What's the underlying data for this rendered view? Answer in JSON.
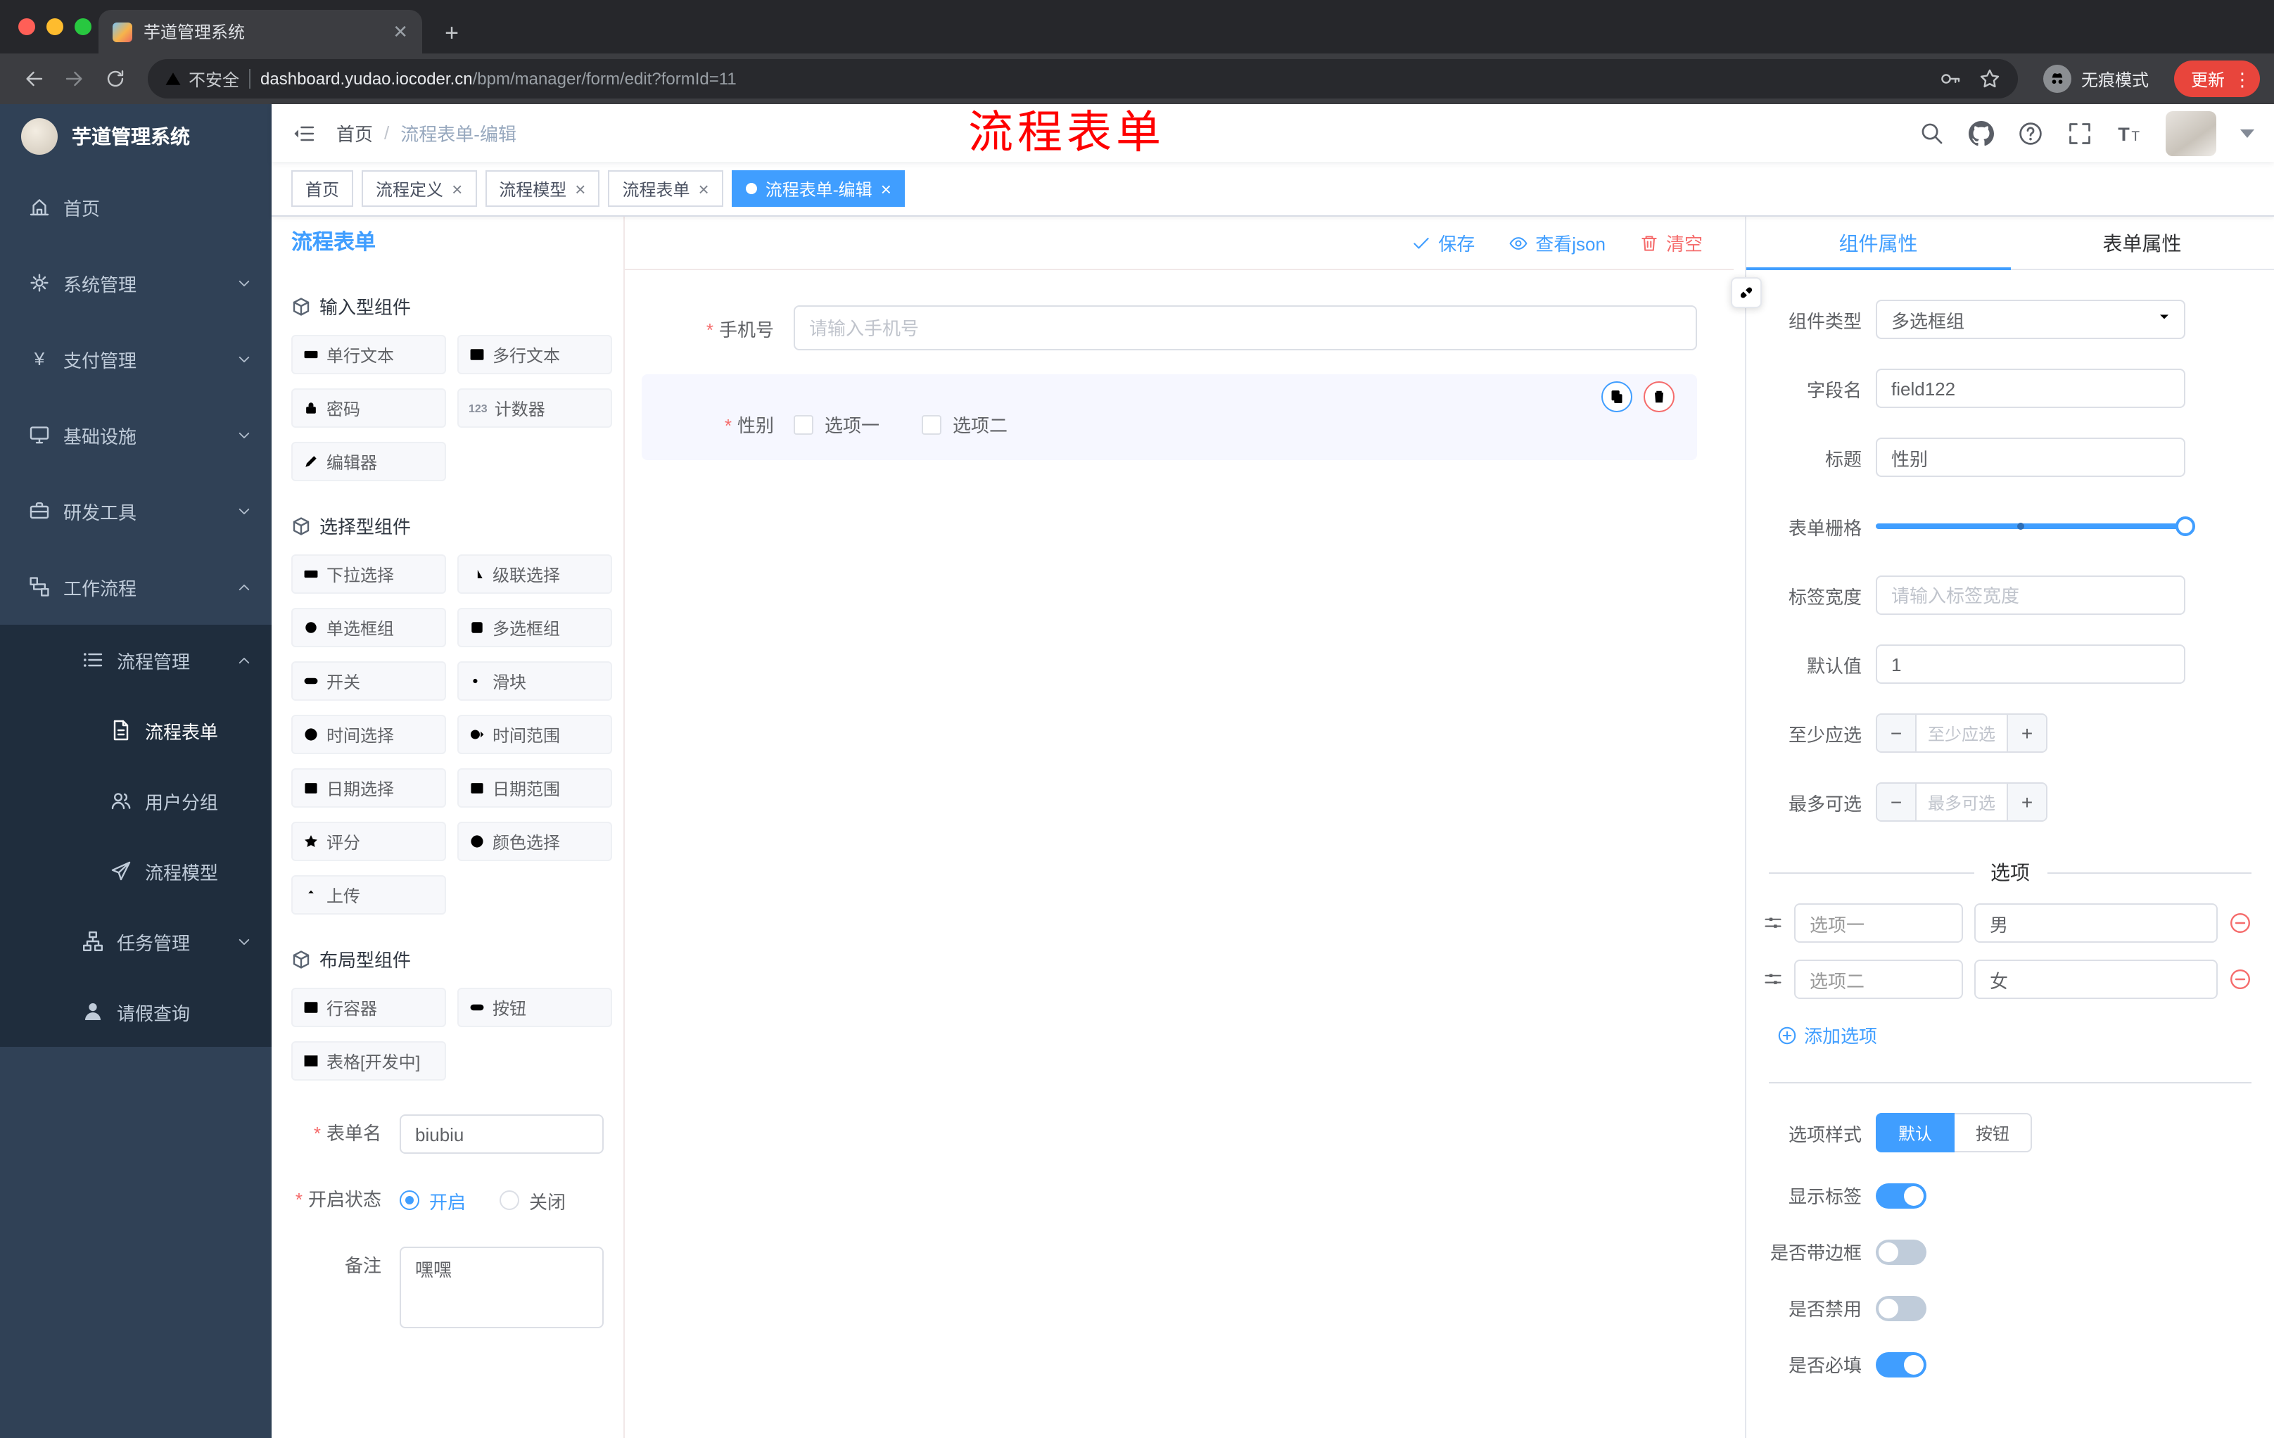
{
  "browser": {
    "tab_title": "芋道管理系统",
    "security_label": "不安全",
    "url_domain": "dashboard.yudao.iocoder.cn",
    "url_path": "/bpm/manager/form/edit?formId=11",
    "incognito_label": "无痕模式",
    "update_label": "更新"
  },
  "navbar": {
    "breadcrumb": {
      "home": "首页",
      "current": "流程表单-编辑"
    },
    "annotation": "流程表单"
  },
  "sidebar": {
    "brand": "芋道管理系统",
    "items": [
      "首页",
      "系统管理",
      "支付管理",
      "基础设施",
      "研发工具",
      "工作流程"
    ],
    "sub": {
      "process_mgmt": "流程管理",
      "children": [
        "流程表单",
        "用户分组",
        "流程模型"
      ],
      "task_mgmt": "任务管理",
      "leave_query": "请假查询"
    }
  },
  "tags": [
    "首页",
    "流程定义",
    "流程模型",
    "流程表单",
    "流程表单-编辑"
  ],
  "builder": {
    "panel_title": "流程表单",
    "actions": {
      "save": "保存",
      "view_json": "查看json",
      "clear": "清空"
    },
    "groups": [
      {
        "title": "输入型组件",
        "items": [
          "单行文本",
          "多行文本",
          "密码",
          "计数器",
          "编辑器"
        ]
      },
      {
        "title": "选择型组件",
        "items": [
          "下拉选择",
          "级联选择",
          "单选框组",
          "多选框组",
          "开关",
          "滑块",
          "时间选择",
          "时间范围",
          "日期选择",
          "日期范围",
          "评分",
          "颜色选择",
          "上传"
        ]
      },
      {
        "title": "布局型组件",
        "items": [
          "行容器",
          "按钮",
          "表格[开发中]"
        ]
      }
    ],
    "meta": {
      "name_label": "表单名",
      "name_value": "biubiu",
      "status_label": "开启状态",
      "status_on": "开启",
      "status_off": "关闭",
      "remark_label": "备注",
      "remark_value": "嘿嘿"
    },
    "canvas": {
      "phone_label": "手机号",
      "phone_placeholder": "请输入手机号",
      "gender_label": "性别",
      "gender_option1": "选项一",
      "gender_option2": "选项二"
    }
  },
  "props": {
    "tab_component": "组件属性",
    "tab_form": "表单属性",
    "component_type_label": "组件类型",
    "component_type_value": "多选框组",
    "field_name_label": "字段名",
    "field_name_value": "field122",
    "title_label": "标题",
    "title_value": "性别",
    "grid_label": "表单栅格",
    "label_width_label": "标签宽度",
    "label_width_placeholder": "请输入标签宽度",
    "default_label": "默认值",
    "default_value": "1",
    "min_label": "至少应选",
    "min_placeholder": "至少应选",
    "max_label": "最多可选",
    "max_placeholder": "最多可选",
    "options_title": "选项",
    "options": [
      {
        "label": "选项一",
        "value": "男"
      },
      {
        "label": "选项二",
        "value": "女"
      }
    ],
    "add_option": "添加选项",
    "style_label": "选项样式",
    "style_default": "默认",
    "style_button": "按钮",
    "show_label": "显示标签",
    "border_label": "是否带边框",
    "disabled_label": "是否禁用",
    "required_label": "是否必填"
  },
  "colors": {
    "accent": "#409eff",
    "danger": "#f56c6c",
    "annotation": "#fe0000"
  }
}
